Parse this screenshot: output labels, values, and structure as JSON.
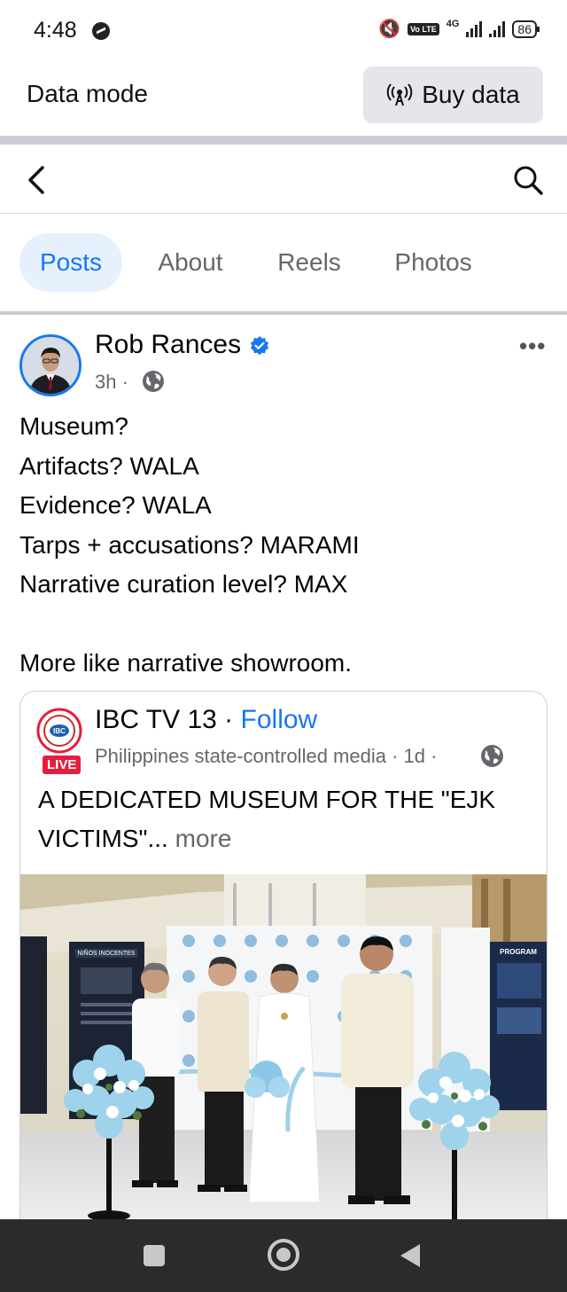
{
  "status_bar": {
    "time": "4:48",
    "network": "4G",
    "volte": "Vo LTE",
    "battery": "86"
  },
  "data_bar": {
    "label": "Data mode",
    "buy_button": "Buy data"
  },
  "tabs": [
    {
      "label": "Posts",
      "active": true
    },
    {
      "label": "About",
      "active": false
    },
    {
      "label": "Reels",
      "active": false
    },
    {
      "label": "Photos",
      "active": false
    }
  ],
  "post": {
    "author": "Rob Rances",
    "time": "3h",
    "dot": "·",
    "more": "•••",
    "lines": [
      "Museum?",
      "Artifacts? WALA",
      "Evidence? WALA",
      "Tarps + accusations? MARAMI",
      "Narrative curation level? MAX",
      "",
      "More like narrative showroom."
    ]
  },
  "shared": {
    "page_name": "IBC TV 13",
    "separator": " · ",
    "follow": "Follow",
    "meta": "Philippines state-controlled media · 1d ·",
    "live": "LIVE",
    "text": "A DEDICATED MUSEUM FOR THE \"EJK VICTIMS\"...",
    "see_more": "more",
    "photo_labels": {
      "left_panel": "NIÑOS INOCENTES",
      "right_panel": "PROGRAM"
    }
  },
  "colors": {
    "accent": "#1877f2",
    "secondary_text": "#65676b",
    "live_red": "#e41e3f",
    "tab_active_bg": "#e7f0fd"
  },
  "icons": [
    "back-icon",
    "search-icon",
    "verified-icon",
    "globe-icon",
    "antenna-icon",
    "more-icon"
  ]
}
